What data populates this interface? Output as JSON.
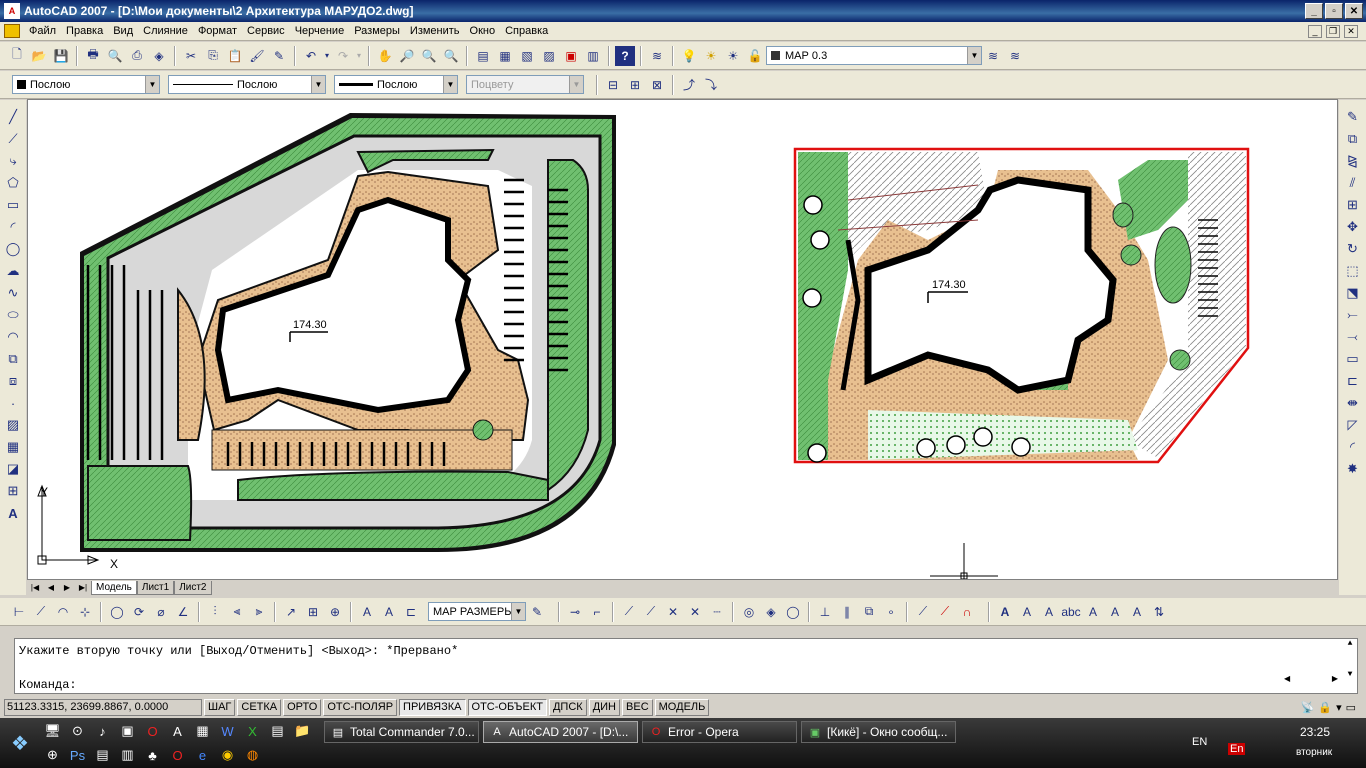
{
  "window": {
    "title": "AutoCAD 2007 - [D:\\Мои документы\\2 Архитектура МАРУДО2.dwg]"
  },
  "menu": [
    "Файл",
    "Правка",
    "Вид",
    "Слияние",
    "Формат",
    "Сервис",
    "Черчение",
    "Размеры",
    "Изменить",
    "Окно",
    "Справка"
  ],
  "layers": {
    "current": "МАР 0.3"
  },
  "properties": {
    "color": "Послою",
    "linetype": "Послою",
    "lineweight": "Послою",
    "plotstyle": "Поцвету"
  },
  "drawing": {
    "elevation_left": "174.30",
    "elevation_right": "174.30",
    "ucs_x": "X",
    "ucs_y": "Y"
  },
  "layout_tabs": [
    "Модель",
    "Лист1",
    "Лист2"
  ],
  "dimstyle": "МАР РАЗМЕРЫ",
  "command": {
    "history": "Укажите вторую точку или [Выход/Отменить] <Выход>: *Прервано*",
    "prompt": "Команда:"
  },
  "status": {
    "coordinates": "51123.3315, 23699.8867, 0.0000",
    "buttons": [
      "ШАГ",
      "СЕТКА",
      "ОРТО",
      "ОТС-ПОЛЯР",
      "ПРИВЯЗКА",
      "ОТС-ОБЪЕКТ",
      "ДПСК",
      "ДИН",
      "ВЕС",
      "МОДЕЛЬ"
    ]
  },
  "taskbar": {
    "tasks": [
      "Total Commander 7.0...",
      "AutoCAD 2007 - [D:\\...",
      "Error - Opera",
      "[Кикё] - Окно сообщ..."
    ],
    "lang": "EN",
    "lang_input": "En",
    "time": "23:25",
    "day": "вторник"
  }
}
